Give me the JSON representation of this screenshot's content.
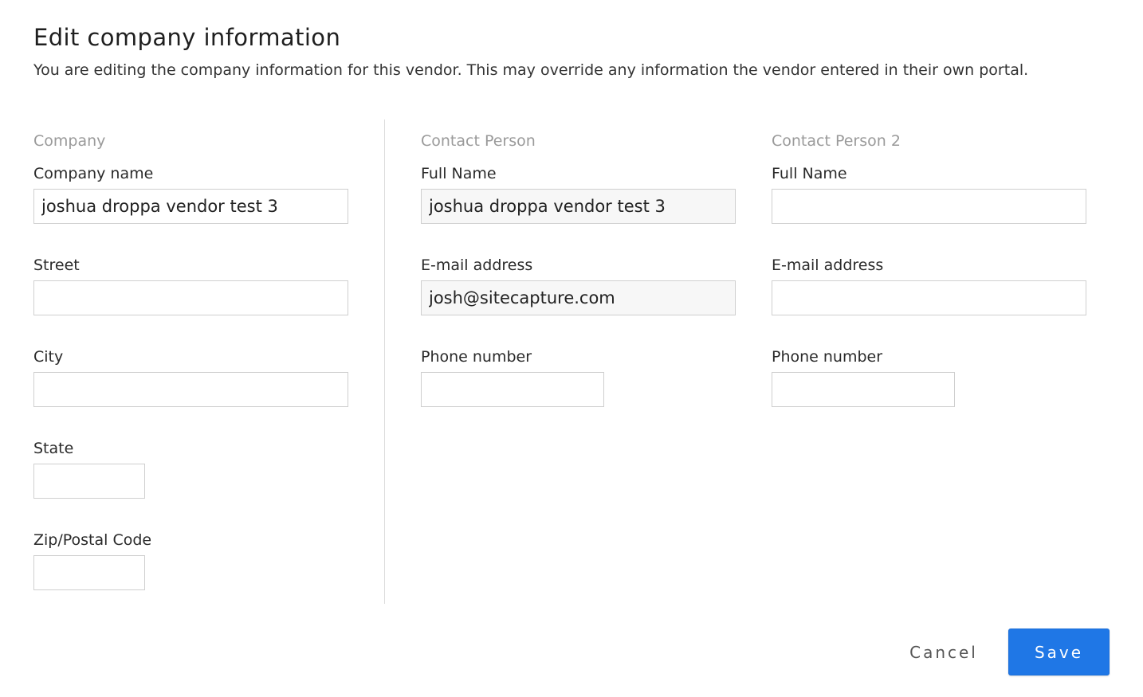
{
  "dialog": {
    "title": "Edit company information",
    "subtitle": "You are editing the company information for this vendor. This may override any information the vendor entered in their own portal."
  },
  "company": {
    "heading": "Company",
    "fields": [
      {
        "label": "Company name",
        "value": "joshua droppa vendor test 3"
      },
      {
        "label": "Street",
        "value": ""
      },
      {
        "label": "City",
        "value": ""
      },
      {
        "label": "State",
        "value": ""
      },
      {
        "label": "Zip/Postal Code",
        "value": ""
      }
    ]
  },
  "contact1": {
    "heading": "Contact Person",
    "fields": [
      {
        "label": "Full Name",
        "value": "joshua droppa vendor test 3"
      },
      {
        "label": "E-mail address",
        "value": "josh@sitecapture.com"
      },
      {
        "label": "Phone number",
        "value": ""
      }
    ]
  },
  "contact2": {
    "heading": "Contact Person 2",
    "fields": [
      {
        "label": "Full Name",
        "value": ""
      },
      {
        "label": "E-mail address",
        "value": ""
      },
      {
        "label": "Phone number",
        "value": ""
      }
    ]
  },
  "actions": {
    "cancel_label": "Cancel",
    "save_label": "Save"
  },
  "colors": {
    "primary": "#1f77e6",
    "section_heading": "#9a9a9a",
    "input_border": "#cfcfcf"
  }
}
